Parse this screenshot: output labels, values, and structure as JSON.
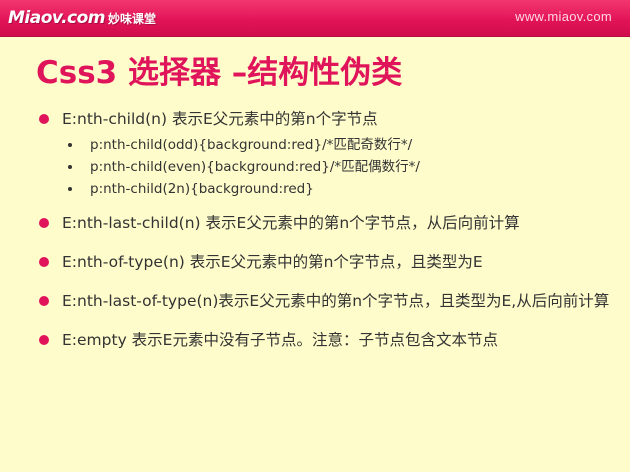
{
  "header": {
    "logo_main": "Miaov.com",
    "logo_sub": "妙味课堂",
    "site_url": "www.miaov.com"
  },
  "title": "Css3 选择器 –结构性伪类",
  "items": [
    {
      "text": "E:nth-child(n)  表示E父元素中的第n个字节点",
      "subitems": [
        "p:nth-child(odd){background:red}/*匹配奇数行*/",
        "p:nth-child(even){background:red}/*匹配偶数行*/",
        "p:nth-child(2n){background:red}"
      ]
    },
    {
      "text": "E:nth-last-child(n) 表示E父元素中的第n个字节点，从后向前计算"
    },
    {
      "text": "E:nth-of-type(n)  表示E父元素中的第n个字节点，且类型为E"
    },
    {
      "text": "E:nth-last-of-type(n)表示E父元素中的第n个字节点，且类型为E,从后向前计算"
    },
    {
      "text": "E:empty 表示E元素中没有子节点。注意：子节点包含文本节点"
    }
  ],
  "colors": {
    "accent": "#e0145a",
    "background": "#fefccb",
    "header": "#e31459",
    "text": "#333333"
  }
}
